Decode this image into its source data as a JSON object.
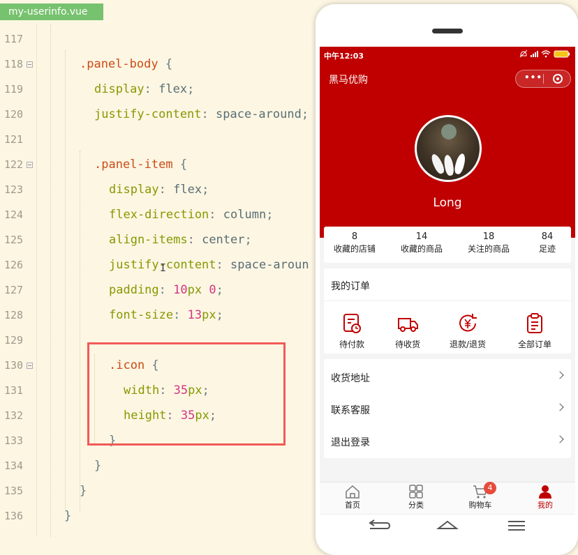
{
  "editor": {
    "file_tab": "my-userinfo.vue",
    "lines": [
      {
        "n": "117",
        "indent": 0,
        "tokens": []
      },
      {
        "n": "118",
        "indent": 1,
        "fold": true,
        "tokens": [
          {
            "c": "sel",
            "t": ".panel-body"
          },
          {
            "c": "punc",
            "t": " {"
          }
        ]
      },
      {
        "n": "119",
        "indent": 2,
        "tokens": [
          {
            "c": "prop",
            "t": "display"
          },
          {
            "c": "punc",
            "t": ": "
          },
          {
            "c": "val",
            "t": "flex"
          },
          {
            "c": "punc",
            "t": ";"
          }
        ]
      },
      {
        "n": "120",
        "indent": 2,
        "tokens": [
          {
            "c": "prop",
            "t": "justify-content"
          },
          {
            "c": "punc",
            "t": ": "
          },
          {
            "c": "val",
            "t": "space-around"
          },
          {
            "c": "punc",
            "t": ";"
          }
        ]
      },
      {
        "n": "121",
        "indent": 0,
        "tokens": []
      },
      {
        "n": "122",
        "indent": 2,
        "fold": true,
        "tokens": [
          {
            "c": "sel",
            "t": ".panel-item"
          },
          {
            "c": "punc",
            "t": " {"
          }
        ]
      },
      {
        "n": "123",
        "indent": 3,
        "tokens": [
          {
            "c": "prop",
            "t": "display"
          },
          {
            "c": "punc",
            "t": ": "
          },
          {
            "c": "val",
            "t": "flex"
          },
          {
            "c": "punc",
            "t": ";"
          }
        ]
      },
      {
        "n": "124",
        "indent": 3,
        "tokens": [
          {
            "c": "prop",
            "t": "flex-direction"
          },
          {
            "c": "punc",
            "t": ": "
          },
          {
            "c": "val",
            "t": "column"
          },
          {
            "c": "punc",
            "t": ";"
          }
        ]
      },
      {
        "n": "125",
        "indent": 3,
        "tokens": [
          {
            "c": "prop",
            "t": "align-items"
          },
          {
            "c": "punc",
            "t": ": "
          },
          {
            "c": "val",
            "t": "center"
          },
          {
            "c": "punc",
            "t": ";"
          }
        ]
      },
      {
        "n": "126",
        "indent": 3,
        "tokens": [
          {
            "c": "prop",
            "t": "justify-content"
          },
          {
            "c": "punc",
            "t": ": "
          },
          {
            "c": "val",
            "t": "space-aroun"
          }
        ]
      },
      {
        "n": "127",
        "indent": 3,
        "tokens": [
          {
            "c": "prop",
            "t": "padding"
          },
          {
            "c": "punc",
            "t": ": "
          },
          {
            "c": "num",
            "t": "10"
          },
          {
            "c": "unit",
            "t": "px"
          },
          {
            "c": "val",
            "t": " "
          },
          {
            "c": "num",
            "t": "0"
          },
          {
            "c": "punc",
            "t": ";"
          }
        ]
      },
      {
        "n": "128",
        "indent": 3,
        "tokens": [
          {
            "c": "prop",
            "t": "font-size"
          },
          {
            "c": "punc",
            "t": ": "
          },
          {
            "c": "num",
            "t": "13"
          },
          {
            "c": "unit",
            "t": "px"
          },
          {
            "c": "punc",
            "t": ";"
          }
        ]
      },
      {
        "n": "129",
        "indent": 0,
        "tokens": []
      },
      {
        "n": "130",
        "indent": 3,
        "fold": true,
        "tokens": [
          {
            "c": "sel",
            "t": ".icon"
          },
          {
            "c": "punc",
            "t": " {"
          }
        ]
      },
      {
        "n": "131",
        "indent": 4,
        "tokens": [
          {
            "c": "prop",
            "t": "width"
          },
          {
            "c": "punc",
            "t": ": "
          },
          {
            "c": "num",
            "t": "35"
          },
          {
            "c": "unit",
            "t": "px"
          },
          {
            "c": "punc",
            "t": ";"
          }
        ]
      },
      {
        "n": "132",
        "indent": 4,
        "tokens": [
          {
            "c": "prop",
            "t": "height"
          },
          {
            "c": "punc",
            "t": ": "
          },
          {
            "c": "num",
            "t": "35"
          },
          {
            "c": "unit",
            "t": "px"
          },
          {
            "c": "punc",
            "t": ";"
          }
        ]
      },
      {
        "n": "133",
        "indent": 3,
        "tokens": [
          {
            "c": "punc",
            "t": "}"
          }
        ]
      },
      {
        "n": "134",
        "indent": 2,
        "tokens": [
          {
            "c": "punc",
            "t": "}"
          }
        ]
      },
      {
        "n": "135",
        "indent": 1,
        "tokens": [
          {
            "c": "punc",
            "t": "}"
          }
        ]
      },
      {
        "n": "136",
        "indent": 0,
        "tokens": [
          {
            "c": "punc",
            "t": "}"
          }
        ]
      }
    ]
  },
  "phone": {
    "status_time": "中午12:03",
    "nav_title": "黑马优购",
    "capsule_more": "•••",
    "username": "Long",
    "stats": [
      {
        "value": "8",
        "label": "收藏的店铺"
      },
      {
        "value": "14",
        "label": "收藏的商品"
      },
      {
        "value": "18",
        "label": "关注的商品"
      },
      {
        "value": "84",
        "label": "足迹"
      }
    ],
    "orders_title": "我的订单",
    "orders": [
      {
        "label": "待付款",
        "icon": "pending-payment-icon"
      },
      {
        "label": "待收货",
        "icon": "delivery-truck-icon"
      },
      {
        "label": "退款/退货",
        "icon": "refund-icon"
      },
      {
        "label": "全部订单",
        "icon": "clipboard-icon"
      }
    ],
    "menu": [
      "收货地址",
      "联系客服",
      "退出登录"
    ],
    "tabs": [
      {
        "label": "首页",
        "icon": "home-icon"
      },
      {
        "label": "分类",
        "icon": "category-icon"
      },
      {
        "label": "购物车",
        "icon": "cart-icon",
        "badge": "4"
      },
      {
        "label": "我的",
        "icon": "user-icon",
        "active": true
      }
    ],
    "accent_color": "#c00000"
  }
}
